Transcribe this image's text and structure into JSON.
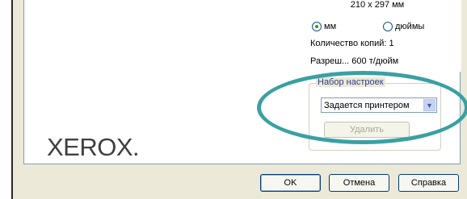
{
  "preview": {
    "paper_size": "210 x 297 мм",
    "units": {
      "mm_label": "мм",
      "inch_label": "дюймы",
      "selected": "mm"
    },
    "copies_line": "Количество копий: 1",
    "resolution_line": "Разреш... 600 т/дюйм",
    "logo": "XEROX."
  },
  "presets": {
    "group_title": "Набор настроек",
    "selected_value": "Задается принтером",
    "delete_label": "Удалить"
  },
  "footer": {
    "ok_label": "OK",
    "cancel_label": "Отмена",
    "help_label": "Справка"
  },
  "colors": {
    "highlight_ring": "#3aa0a2",
    "dialog_bg": "#ece9d8"
  },
  "icons": {
    "dropdown": "chevron-down-icon"
  }
}
